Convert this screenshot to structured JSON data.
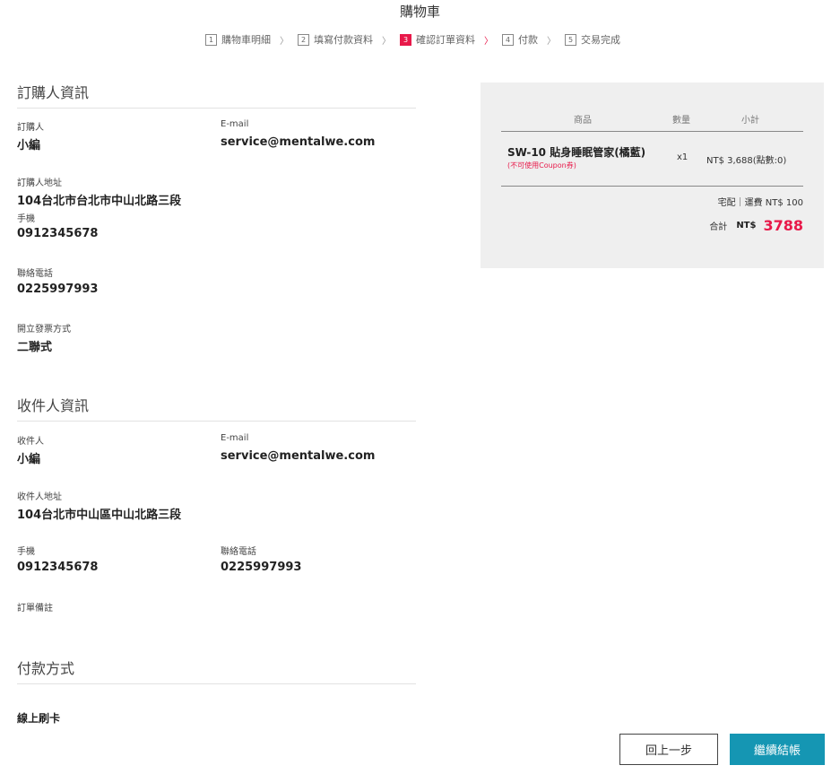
{
  "page": {
    "title": "購物車"
  },
  "steps": [
    {
      "num": "1",
      "label": "購物車明細"
    },
    {
      "num": "2",
      "label": "填寫付款資料"
    },
    {
      "num": "3",
      "label": "確認訂單資料"
    },
    {
      "num": "4",
      "label": "付款"
    },
    {
      "num": "5",
      "label": "交易完成"
    }
  ],
  "chevron": "〉",
  "buyer": {
    "title": "訂購人資訊",
    "name_label": "訂購人",
    "name": "小編",
    "email_label": "E-mail",
    "email": "service@mentalwe.com",
    "address_label": "訂購人地址",
    "address": "104台北市台北市中山北路三段",
    "mobile_label": "手機",
    "mobile": "0912345678",
    "phone_label": "聯絡電話",
    "phone": "0225997993",
    "invoice_label": "開立發票方式",
    "invoice": "二聯式"
  },
  "recipient": {
    "title": "收件人資訊",
    "name_label": "收件人",
    "name": "小編",
    "email_label": "E-mail",
    "email": "service@mentalwe.com",
    "address_label": "收件人地址",
    "address": "104台北市中山區中山北路三段",
    "mobile_label": "手機",
    "mobile": "0912345678",
    "phone_label": "聯絡電話",
    "phone": "0225997993",
    "note_label": "訂單備註"
  },
  "payment": {
    "title": "付款方式",
    "method": "線上刷卡"
  },
  "summary": {
    "col_product": "商品",
    "col_qty": "數量",
    "col_subtotal": "小計",
    "product_name": "SW-10 貼身睡眠管家(橘藍)",
    "product_note": "(不可使用Coupon券)",
    "qty": "x1",
    "subtotal": "NT$ 3,688(點數:0)",
    "shipping": "宅配｜運費 NT$ 100",
    "total_label": "合計",
    "currency": "NT$",
    "total": "3788"
  },
  "buttons": {
    "back": "回上一步",
    "next": "繼續結帳"
  },
  "colors": {
    "accent": "#e8194a",
    "primary_button": "#1596b3",
    "summary_bg": "#efefef"
  }
}
